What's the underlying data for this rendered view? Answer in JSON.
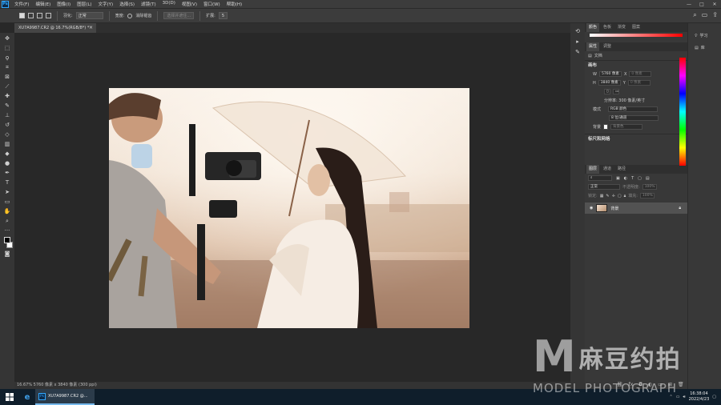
{
  "app": {
    "logo_text": "Ps"
  },
  "menubar": {
    "items": [
      "文件(F)",
      "编辑(E)",
      "图像(I)",
      "图层(L)",
      "文字(Y)",
      "选择(S)",
      "滤镜(T)",
      "3D(D)",
      "视图(V)",
      "窗口(W)",
      "帮助(H)"
    ],
    "window_controls": [
      "—",
      "□",
      "✕"
    ]
  },
  "options_bar": {
    "feather_label": "羽化:",
    "mode_label": "正常",
    "width_label": "宽度:",
    "antialias_label": "消除锯齿",
    "mask_button": "选择并遮住...",
    "expand_label": "扩展:",
    "expand_value": "5"
  },
  "document": {
    "tab_title": "XU7A9987.CR2 @ 16.7%(RGB/8*) *",
    "tab_close": "×",
    "status": "16.67%   5760 像素 x 3840 像素 (300 ppi)"
  },
  "toolbar": {
    "tools": [
      "move-tool-icon",
      "marquee-tool-icon",
      "lasso-tool-icon",
      "crop-tool-icon",
      "frame-tool-icon",
      "eyedropper-tool-icon",
      "healing-tool-icon",
      "brush-tool-icon",
      "stamp-tool-icon",
      "history-brush-icon",
      "eraser-tool-icon",
      "gradient-tool-icon",
      "blur-tool-icon",
      "dodge-tool-icon",
      "pen-tool-icon",
      "type-tool-icon",
      "path-select-icon",
      "shape-tool-icon",
      "hand-tool-icon",
      "zoom-tool-icon",
      "more-tools-icon"
    ]
  },
  "color_panel": {
    "tabs": [
      "颜色",
      "色板",
      "渐变",
      "图案"
    ]
  },
  "properties_panel": {
    "tabs": [
      "属性",
      "调整"
    ],
    "doc_label": "文档",
    "canvas_title": "画布",
    "w_label": "W",
    "w_value": "5760 像素",
    "x_label": "X",
    "x_placeholder": "0 像素",
    "h_label": "H",
    "h_value": "3840 像素",
    "y_label": "Y",
    "y_placeholder": "0 像素",
    "resolution": "分辨率: 300 像素/英寸",
    "mode_label": "模式",
    "mode_value": "RGB 颜色",
    "depth_value": "8 位/通道",
    "bg_label": "背景",
    "bg_value": "背景色",
    "rulers_title": "标尺和网格"
  },
  "layers_panel": {
    "tabs": [
      "图层",
      "通道",
      "路径"
    ],
    "blend_mode": "正常",
    "opacity_label": "不透明度:",
    "opacity_value": "100%",
    "lock_label": "锁定:",
    "fill_label": "填充:",
    "fill_value": "100%",
    "layer_name": "背景"
  },
  "right_strip": {
    "learn_label": "学习",
    "libraries_label": "库"
  },
  "taskbar": {
    "ps_task_label": "XU7A9987.CR2 @...",
    "time": "16:38:04",
    "date": "2022/4/23"
  },
  "watermark": {
    "brand_cn": "麻豆约拍",
    "brand_en": "MODEL PHOTOGRAPH"
  },
  "colors": {
    "accent": "#31a8ff",
    "photo_highlight": "#f7ede3",
    "photo_shadow": "#a9836a"
  }
}
